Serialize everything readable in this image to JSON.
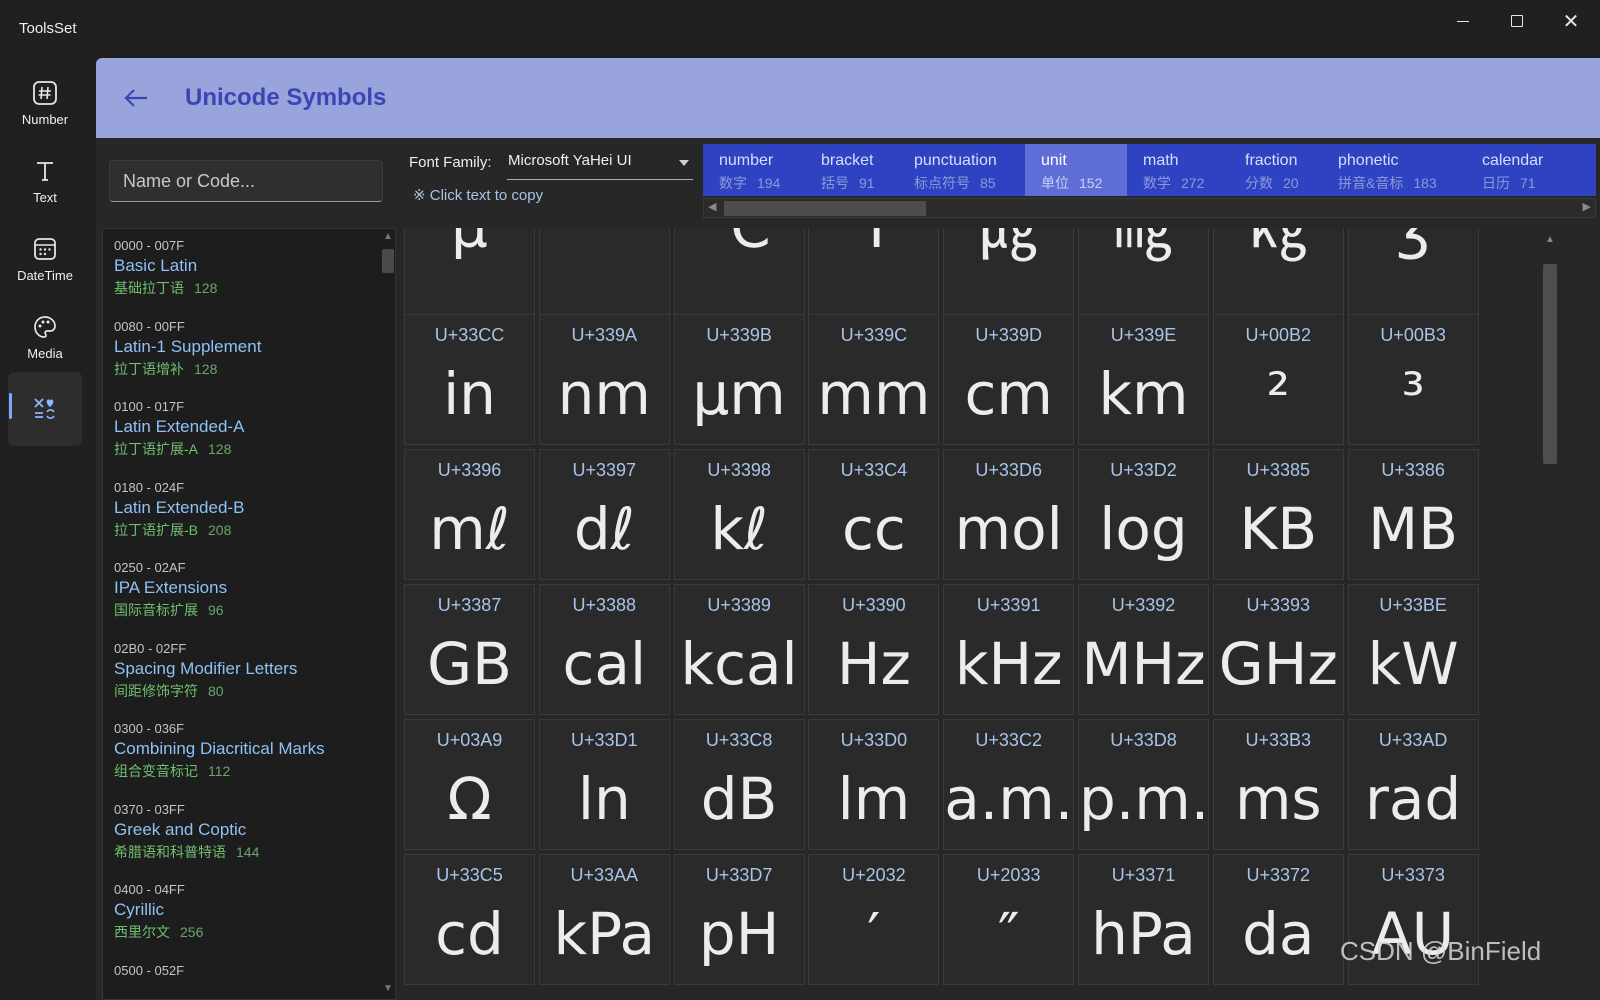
{
  "app": {
    "title": "ToolsSet"
  },
  "nav": {
    "items": [
      {
        "label": "Number",
        "icon": "hash-icon"
      },
      {
        "label": "Text",
        "icon": "text-icon"
      },
      {
        "label": "DateTime",
        "icon": "calendar-icon"
      },
      {
        "label": "Media",
        "icon": "palette-icon"
      },
      {
        "label": "",
        "icon": "symbols-icon",
        "active": true
      }
    ]
  },
  "header": {
    "title": "Unicode Symbols"
  },
  "search": {
    "placeholder": "Name or Code..."
  },
  "blocks": [
    {
      "range": "0000 - 007F",
      "name": "Basic Latin",
      "cn": "基础拉丁语",
      "count": "128"
    },
    {
      "range": "0080 - 00FF",
      "name": "Latin-1 Supplement",
      "cn": "拉丁语增补",
      "count": "128"
    },
    {
      "range": "0100 - 017F",
      "name": "Latin Extended-A",
      "cn": "拉丁语扩展-A",
      "count": "128"
    },
    {
      "range": "0180 - 024F",
      "name": "Latin Extended-B",
      "cn": "拉丁语扩展-B",
      "count": "208"
    },
    {
      "range": "0250 - 02AF",
      "name": "IPA Extensions",
      "cn": "国际音标扩展",
      "count": "96"
    },
    {
      "range": "02B0 - 02FF",
      "name": "Spacing Modifier Letters",
      "cn": "间距修饰字符",
      "count": "80"
    },
    {
      "range": "0300 - 036F",
      "name": "Combining Diacritical Marks",
      "cn": "组合变音标记",
      "count": "112"
    },
    {
      "range": "0370 - 03FF",
      "name": "Greek and Coptic",
      "cn": "希腊语和科普特语",
      "count": "144"
    },
    {
      "range": "0400 - 04FF",
      "name": "Cyrillic",
      "cn": "西里尔文",
      "count": "256"
    },
    {
      "range": "0500 - 052F",
      "name": "",
      "cn": "",
      "count": ""
    }
  ],
  "font": {
    "label": "Font Family:",
    "value": "Microsoft YaHei UI"
  },
  "hint": "※ Click text to copy",
  "categories": [
    {
      "name": "number",
      "cn": "数字",
      "count": "194"
    },
    {
      "name": "bracket",
      "cn": "括号",
      "count": "91"
    },
    {
      "name": "punctuation",
      "cn": "标点符号",
      "count": "85"
    },
    {
      "name": "unit",
      "cn": "单位",
      "count": "152",
      "active": true
    },
    {
      "name": "math",
      "cn": "数学",
      "count": "272"
    },
    {
      "name": "fraction",
      "cn": "分数",
      "count": "20"
    },
    {
      "name": "phonetic",
      "cn": "拼音&音标",
      "count": "183"
    },
    {
      "name": "calendar",
      "cn": "日历",
      "count": "71"
    }
  ],
  "symbols": [
    [
      {
        "code": "",
        "glyph": "µ"
      },
      {
        "code": "",
        "glyph": "°"
      },
      {
        "code": "",
        "glyph": "℃"
      },
      {
        "code": "",
        "glyph": "℉"
      },
      {
        "code": "",
        "glyph": "㎍"
      },
      {
        "code": "",
        "glyph": "㎎"
      },
      {
        "code": "",
        "glyph": "㎏"
      },
      {
        "code": "",
        "glyph": "ʒ"
      }
    ],
    [
      {
        "code": "U+33CC",
        "glyph": "in"
      },
      {
        "code": "U+339A",
        "glyph": "nm"
      },
      {
        "code": "U+339B",
        "glyph": "μm"
      },
      {
        "code": "U+339C",
        "glyph": "mm"
      },
      {
        "code": "U+339D",
        "glyph": "cm"
      },
      {
        "code": "U+339E",
        "glyph": "km"
      },
      {
        "code": "U+00B2",
        "glyph": "²"
      },
      {
        "code": "U+00B3",
        "glyph": "³"
      }
    ],
    [
      {
        "code": "U+3396",
        "glyph": "mℓ"
      },
      {
        "code": "U+3397",
        "glyph": "dℓ"
      },
      {
        "code": "U+3398",
        "glyph": "kℓ"
      },
      {
        "code": "U+33C4",
        "glyph": "cc"
      },
      {
        "code": "U+33D6",
        "glyph": "mol"
      },
      {
        "code": "U+33D2",
        "glyph": "log"
      },
      {
        "code": "U+3385",
        "glyph": "KB"
      },
      {
        "code": "U+3386",
        "glyph": "MB"
      }
    ],
    [
      {
        "code": "U+3387",
        "glyph": "GB"
      },
      {
        "code": "U+3388",
        "glyph": "cal"
      },
      {
        "code": "U+3389",
        "glyph": "kcal"
      },
      {
        "code": "U+3390",
        "glyph": "Hz"
      },
      {
        "code": "U+3391",
        "glyph": "kHz"
      },
      {
        "code": "U+3392",
        "glyph": "MHz"
      },
      {
        "code": "U+3393",
        "glyph": "GHz"
      },
      {
        "code": "U+33BE",
        "glyph": "kW"
      }
    ],
    [
      {
        "code": "U+03A9",
        "glyph": "Ω"
      },
      {
        "code": "U+33D1",
        "glyph": "ln"
      },
      {
        "code": "U+33C8",
        "glyph": "dB"
      },
      {
        "code": "U+33D0",
        "glyph": "lm"
      },
      {
        "code": "U+33C2",
        "glyph": "a.m."
      },
      {
        "code": "U+33D8",
        "glyph": "p.m."
      },
      {
        "code": "U+33B3",
        "glyph": "ms"
      },
      {
        "code": "U+33AD",
        "glyph": "rad"
      }
    ],
    [
      {
        "code": "U+33C5",
        "glyph": "cd"
      },
      {
        "code": "U+33AA",
        "glyph": "kPa"
      },
      {
        "code": "U+33D7",
        "glyph": "pH"
      },
      {
        "code": "U+2032",
        "glyph": "′"
      },
      {
        "code": "U+2033",
        "glyph": "″"
      },
      {
        "code": "U+3371",
        "glyph": "hPa"
      },
      {
        "code": "U+3372",
        "glyph": "da"
      },
      {
        "code": "U+3373",
        "glyph": "AU"
      }
    ]
  ],
  "watermark": "CSDN @BinField"
}
